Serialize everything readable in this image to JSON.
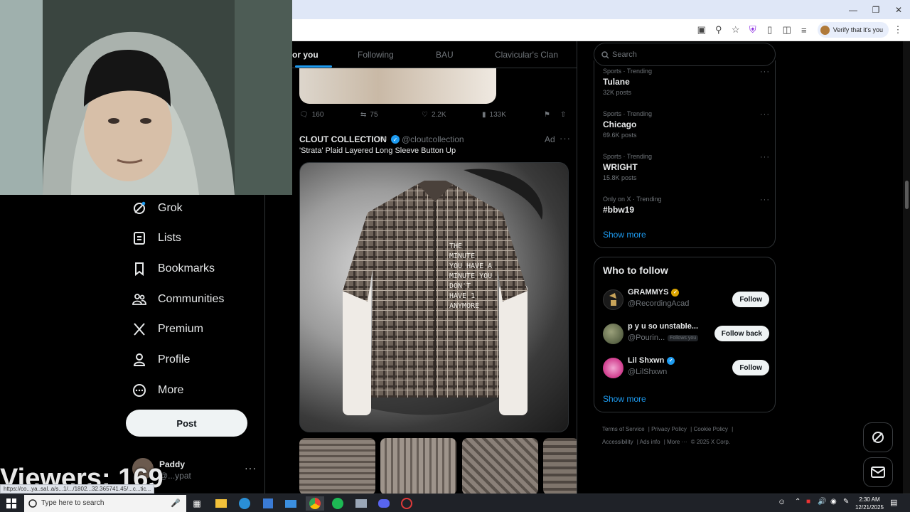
{
  "browser": {
    "verify_chip": "Verify that it's you",
    "window_controls": [
      "minimize-icon",
      "restore-icon",
      "close-icon"
    ],
    "toolbar_icons": [
      "install-icon",
      "zoom-icon",
      "star-icon",
      "shield-icon",
      "extensions-icon",
      "split-icon",
      "playlist-icon"
    ]
  },
  "stream": {
    "viewers": "Viewers: 169"
  },
  "status_url": "https://co...ya..sal..a/s...1/.../1802...32.365741.45/...c...tic...",
  "nav": {
    "items": [
      {
        "label": "Grok",
        "icon": "grok-icon"
      },
      {
        "label": "Lists",
        "icon": "lists-icon"
      },
      {
        "label": "Bookmarks",
        "icon": "bookmark-icon"
      },
      {
        "label": "Communities",
        "icon": "communities-icon"
      },
      {
        "label": "Premium",
        "icon": "x-logo-icon"
      },
      {
        "label": "Profile",
        "icon": "profile-icon"
      },
      {
        "label": "More",
        "icon": "more-circle-icon"
      }
    ],
    "post_label": "Post",
    "account": {
      "name": "Paddy",
      "handle": "@...ypat"
    }
  },
  "feed": {
    "tabs": [
      "or you",
      "Following",
      "BAU",
      "Clavicular's Clan"
    ],
    "prev_post_actions": {
      "replies": "160",
      "reposts": "75",
      "likes": "2.2K",
      "views": "133K"
    },
    "ad": {
      "name": "CLOUT COLLECTION",
      "tm": "TM",
      "handle": "@cloutcollection",
      "label": "Ad",
      "text": "'Strata' Plaid Layered Long Sleeve Button Up",
      "shirt_text": [
        "THE",
        "MINUTE",
        "YOU HAVE A",
        "MINUTE YOU",
        "DON'T",
        "HAVE 1",
        "ANYMORE"
      ]
    }
  },
  "sidebar": {
    "search_placeholder": "Search",
    "trends": [
      {
        "context": "Sports · Trending",
        "name": "Tulane",
        "count": "32K posts"
      },
      {
        "context": "Sports · Trending",
        "name": "Chicago",
        "count": "69.6K posts"
      },
      {
        "context": "Sports · Trending",
        "name": "WRIGHT",
        "count": "15.8K posts"
      },
      {
        "context": "Only on X · Trending",
        "name": "#bbw19",
        "count": ""
      }
    ],
    "trends_show_more": "Show more",
    "who_to_follow": {
      "title": "Who to follow",
      "accounts": [
        {
          "name": "GRAMMYS",
          "handle": "@RecordingAcad",
          "button": "Follow",
          "badge": "gold",
          "follows_you": ""
        },
        {
          "name": "p y u so unstable...",
          "handle": "@Pourin...",
          "button": "Follow back",
          "badge": "",
          "follows_you": "Follows you"
        },
        {
          "name": "Lil Shxwn",
          "handle": "@LilShxwn",
          "button": "Follow",
          "badge": "blue",
          "follows_you": ""
        }
      ],
      "show_more": "Show more"
    },
    "footer": [
      "Terms of Service",
      "Privacy Policy",
      "Cookie Policy",
      "Accessibility",
      "Ads info",
      "More ···",
      "© 2025 X Corp."
    ]
  },
  "taskbar": {
    "search_placeholder": "Type here to search",
    "time": "2:30 AM",
    "date": "12/21/2025",
    "apps": [
      "task-view-icon",
      "file-explorer-icon",
      "edge-icon",
      "store-icon",
      "mail-icon",
      "chrome-icon",
      "spotify-icon",
      "app-icon",
      "discord-icon",
      "app-red-icon"
    ]
  },
  "colors": {
    "accent": "#1d9bf0",
    "background": "#000000",
    "border": "#2f3336",
    "muted": "#71767b"
  }
}
